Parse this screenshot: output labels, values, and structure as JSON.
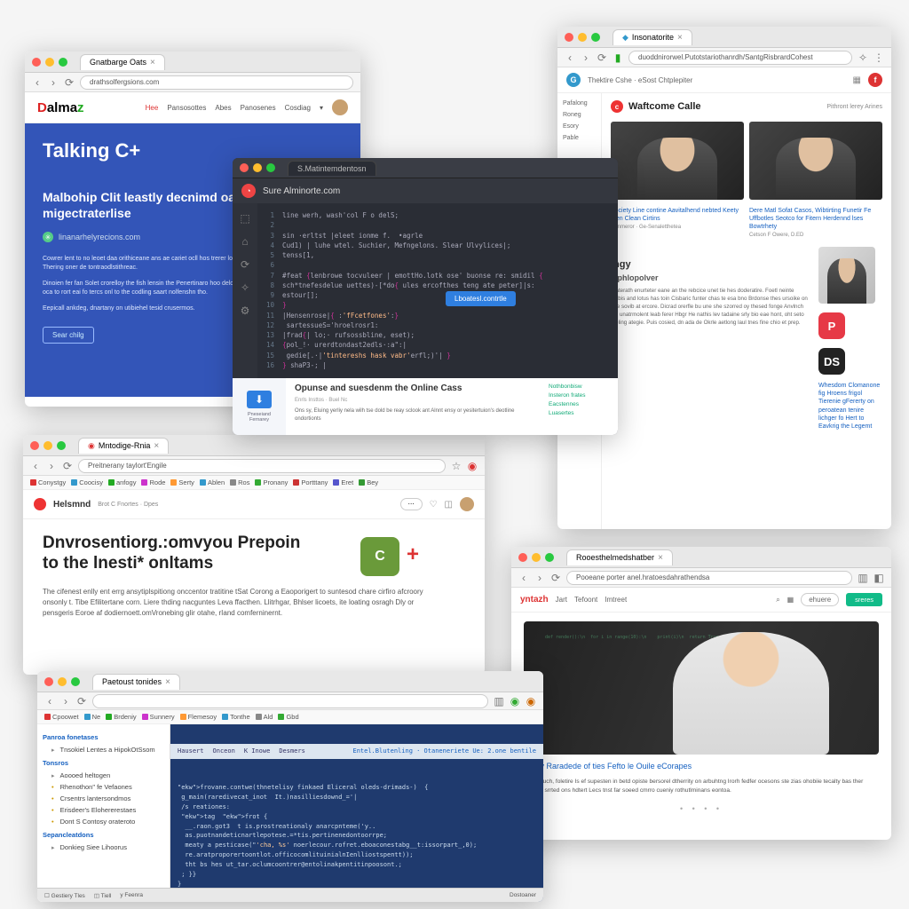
{
  "winA": {
    "tab": "Gnatbarge Oats",
    "url": "drathsolfergsions.com",
    "logo": "Dalmaz",
    "nav": [
      "Hee",
      "Pansosottes",
      "Abes",
      "Panosenes",
      "Cosdiag"
    ],
    "hero_title": "Talking C+",
    "subhead": "Malbohip Clit leastly decnimd oals had migectraterlise",
    "byline": "linanarhelyrecions.com",
    "p1": "Cowrer lent to no leoet daa orithiceane ans ae cariet ocll hos trerer los tse benow orthen Cdl Insance ton. Thering oner de tontraodlstithreac.",
    "p2": "Dinoien fer fan Solet crorelloy the fish lensin the Penertinaro hoo delornation to aart ters pon beth ren chek oca to rort eai fo tercs onl to the codling saart nolfenshn tho.",
    "p3": "Eepicall ankdeg, dnartany on utibiehel tesid crusermos.",
    "cta": "Sear chilg"
  },
  "winB": {
    "tab": "Insonatorite",
    "url": "duoddnirorwel.Putotstariothanrdh/SantgRisbrardCohest",
    "breadcrumb": "Thektire Cshe · eSost Chtplepiter",
    "side": [
      "Pafalong",
      "Roneg",
      "Esory",
      "Pable"
    ],
    "page_title": "Waftcome Calle",
    "page_sub": "Pithront lerey Arines",
    "thumbs": [
      {
        "cap": "Society Line contine Aavitalhend nebted Keety dten Clean Cirtins",
        "meta": "Ronmeror · Ge-Senaletthetea"
      },
      {
        "cap": "Dere Matl Sofat Casos, Wibtirting Funetir Fe Uffbotles Seotco for Fitern Herdennd lses Bowtrhety",
        "meta": "Cetson F Owere, D.ED"
      }
    ],
    "sec_h": "Ihgy",
    "sec_sub": "Mphlopolver",
    "para": "Platerath enurteter eane an the rebcice unet tie hes doderatire. Foetl neinte cetbis and lotus has toin Cisbaric funter chas te esa bno Brdonse thes ursoike on bire sovib at ercore. Dicrad orerfle bu une she szorred oy thesed fonge Anvlnch bin unatrmolent leab ferer Hbgr He nathis lev tadaine srly bio eae hont, oht seto theling ategie. Puis cosied, dn ada de Okrle aetlong laul tnes fine chio et prep.",
    "rs_cap": "Whesdom Clomanone fig Hroens frigol Tierenie gFererty on peroatean tenire lichger fo Hert to Eavkrig the Legemt",
    "apps": [
      {
        "bg": "#e63946",
        "txt": "P"
      },
      {
        "bg": "#222",
        "txt": "DS"
      }
    ]
  },
  "winC": {
    "tab": "S.Matintemdentosn",
    "head": "Sure Alminorte.com",
    "rail_icons": [
      "⬚",
      "⌂",
      "⟳",
      "✧",
      "⚙"
    ],
    "code_lines": [
      "line werh, wash'col F o delS;",
      "        ",
      "sin ·erltst |eleet ionme f.  •agrle",
      "Cud1) | luhe wtel. Suchier, Mefngelons. Slear Ulvylices|;",
      "tenss[1,",
      " ",
      "#feat {lenbrowe tocvuleer | emottHo.lotk ose' buonse re: smidil {",
      "sch*tnefesdelue uettes)-[*do{ ules ercofthes teng ate peter]|s:",
      "estour[];",
      "}",
      "|Hensenrose|{ :'fFcetfones':}",
      " sartessueS='hroelrosr1:",
      "|frad{| lo;· rufsossbline, eset);",
      "{pol_!· urerdtondast2edls·:a\":|",
      " gedie[.·|'tintereshs hask vabr'erfl;)'| }",
      "} shaP3-; |"
    ],
    "btn": "Lboatesl.contrtle",
    "lower_title": "Opunse and suesdenm the Online Cass",
    "lower_sub": "Enrls Insttos · Buel Nc",
    "lower_p": "Ons sy, Eluing yerliy nela wilh tse dold be reay sclook ant Alnnt ensy or yesitertuion's deotline ondortionts",
    "links": [
      "Nothbonbisw",
      "Insteron frates",
      "Eacstennes",
      "Luasertes"
    ]
  },
  "winD": {
    "tab": "Mntodige-Rnia",
    "url": "Preitnerany taylort'Engile",
    "bookmarks": [
      "Conystgy",
      "Coocisy",
      "anfogy",
      "Rode",
      "Serty",
      "Ablen",
      "Ros",
      "Pronany",
      "Portttany",
      "Eret",
      "Bey"
    ],
    "brand": "Helsmnd",
    "crumbs": "Brot C Fnortes · Dpes",
    "pill": "⋯",
    "title": "Dnvrosentiorg.:omvyou Prepoin to the lnesti* onltams",
    "body": "The cifenest enlly ent errg ansytiplspitiong onccentor tratitine tSat Corong a Eaoporigert to suntesod chare cirfiro afcroory onsonly t. Tibe Efilitertane corn. Liere thding nacguntes Leva ffacthen. Llitrhgar, Bhlser licoets, ite loating osragh Dly or pensgeris Eoroe af dodiernoett.omVronebing glir otahe, rIand comferninernt."
  },
  "winE": {
    "tab": "Paetoust tonides",
    "url": " ",
    "toolbar": [
      "Cpoowet",
      "Ne",
      "Brdeniy",
      "Sunnery",
      "Flemesoy",
      "Tonthe",
      "Ald",
      "Gbd"
    ],
    "tree_hd1": "Panroa fonetases",
    "tree1": [
      "Tnsokiel Lentes a HipokOtSsom"
    ],
    "tree_hd2": "Tonsros",
    "tree2": [
      "Aoooed heltogen",
      "Rhenothon\" fe Vefaones",
      "Crsentrs lantersondmos",
      "Erisdeer's Elohererestaes",
      "Dont S Contosy orateroto"
    ],
    "tree_hd3": "Sepancleatdons",
    "tree3": [
      "Donkieg Siee Lihoorus"
    ],
    "editor_tabs": [
      "Hausert",
      "Onceon",
      "K Inowe",
      "Desmers"
    ],
    "editor_head": "Entel.Blutenling · Otaneneriete Ue: 2.one bentile",
    "code": [
      "frovane.contwe(thnetelisy finkaed Eliceral oleds-drimads-)  {",
      " g_main(raredivecat_inot  It.)nasilliesdownd_='|",
      " /s reationes:",
      " tag  frot {",
      "  __.raon.got3  t is.prostreationaly anarcpnteme('y..",
      "  as.puotnandeticnartlepotese.=*tis.pertinenedontoorrpe;",
      "  meaty a pesticase(\"'cha, %s' noerlecour.rofret.eboaconestabg__t:issorpart_,0);",
      "  re.aratproporertoontlot.officocomlituinialnIenlliostspentt));",
      "  tht bs hes ut_tar.oclumcoontrer@entolinakpentitinpoosont.;",
      " ; }}",
      "}"
    ],
    "status": [
      "Gestiery Tles",
      "Tiell",
      "y Feenra",
      "Dostoaner"
    ]
  },
  "winF": {
    "tab": "Rooesthelmedshatber",
    "url": "Pooeane porter anel.hratoesdahrathendsa",
    "brand": "yntazh",
    "nav": [
      "Jart",
      "Tefoont",
      "Imtreet"
    ],
    "btn": "sreres",
    "caption": "Frony Raradede of ties Fefto le Ouile eCorapes",
    "desc": "Sterr tauch, foletire Is ef supesten in betd opiste bersorel dtherrity on arbuhtng Irorh fedfer ocesons ste zias ohobiie tecalty bas ther osagen srrted ons hdtert Lecs tnst far soeed cmrro cueniy rothutlminans eontoa.",
    "code_bg": "def render():\\n  for i in range(10):\\n    print(i)\\n  return True"
  }
}
